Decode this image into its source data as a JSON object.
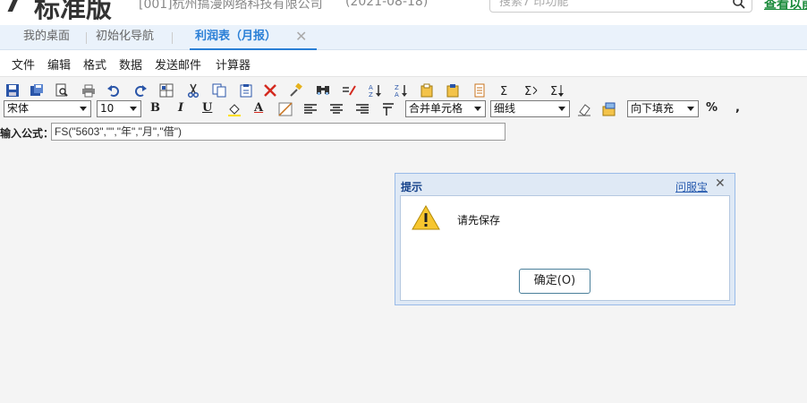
{
  "header": {
    "edition": "标准版",
    "company": "[001]杭州搞漫网络科技有限公司",
    "date": "(2021-08-18)",
    "search_placeholder": "搜索7 印功能",
    "help_link": "查看以前"
  },
  "tabs": [
    {
      "label": "我的桌面"
    },
    {
      "label": "初始化导航"
    },
    {
      "label": "利润表（月报）",
      "active": true
    }
  ],
  "menu": [
    "文件",
    "编辑",
    "格式",
    "数据",
    "发送邮件",
    "计算器"
  ],
  "toolbar": {
    "icons": [
      "save-icon",
      "save-as-icon",
      "print-preview-icon",
      "print-icon",
      "undo-icon",
      "redo-icon",
      "select-all-icon",
      "cut-icon",
      "copy-icon",
      "paste-icon",
      "delete-icon",
      "format-painter-icon",
      "find-icon",
      "replace-icon",
      "sort-ascending-icon",
      "sort-descending-icon",
      "insert-row-icon",
      "insert-col-icon",
      "page-setup-icon",
      "sum-icon",
      "row-sum-icon",
      "col-sum-icon"
    ]
  },
  "format": {
    "font": "宋体",
    "size": "10",
    "bold": "B",
    "italic": "I",
    "underline": "U",
    "font_color": "A",
    "merge": "合并单元格",
    "border": "细线",
    "fill": "向下填充",
    "percent": "%",
    "comma": ","
  },
  "formula": {
    "label": "输入公式：",
    "value": "FS(\"5603\",\"\",\"年\",\"月\",\"借\")"
  },
  "dialog": {
    "title": "提示",
    "help_link": "问服宝",
    "message": "请先保存",
    "ok_label": "确定(O)"
  }
}
